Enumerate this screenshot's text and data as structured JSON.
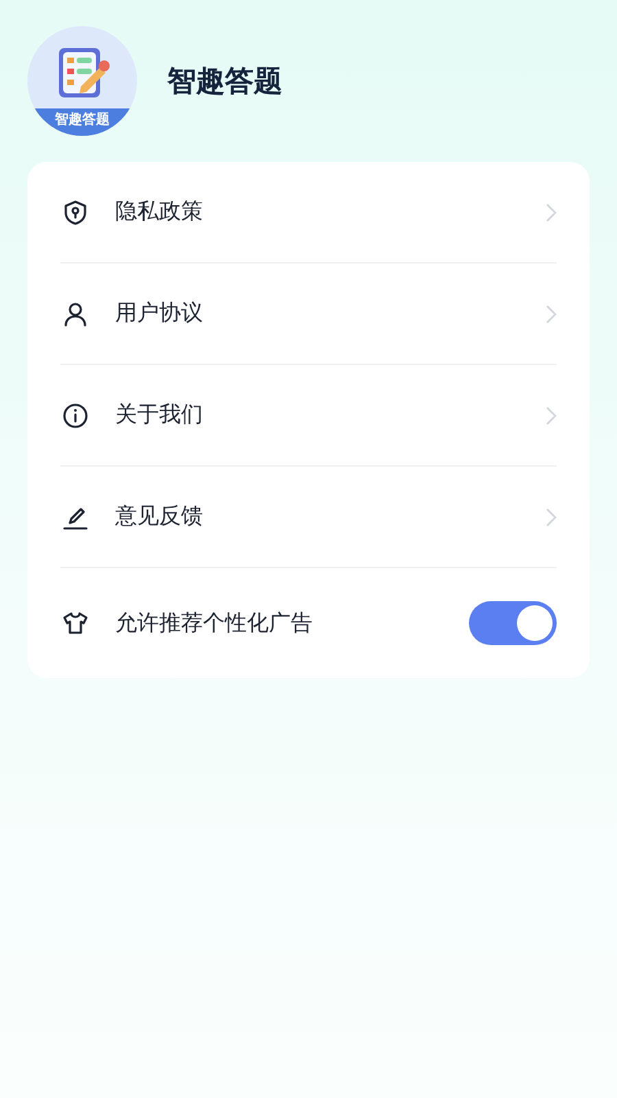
{
  "app": {
    "title": "智趣答题",
    "logo_label": "智趣答题"
  },
  "menu": [
    {
      "kind": "link",
      "label": "隐私政策"
    },
    {
      "kind": "link",
      "label": "用户协议"
    },
    {
      "kind": "link",
      "label": "关于我们"
    },
    {
      "kind": "link",
      "label": "意见反馈"
    },
    {
      "kind": "toggle",
      "label": "允许推荐个性化广告",
      "on": true
    }
  ]
}
